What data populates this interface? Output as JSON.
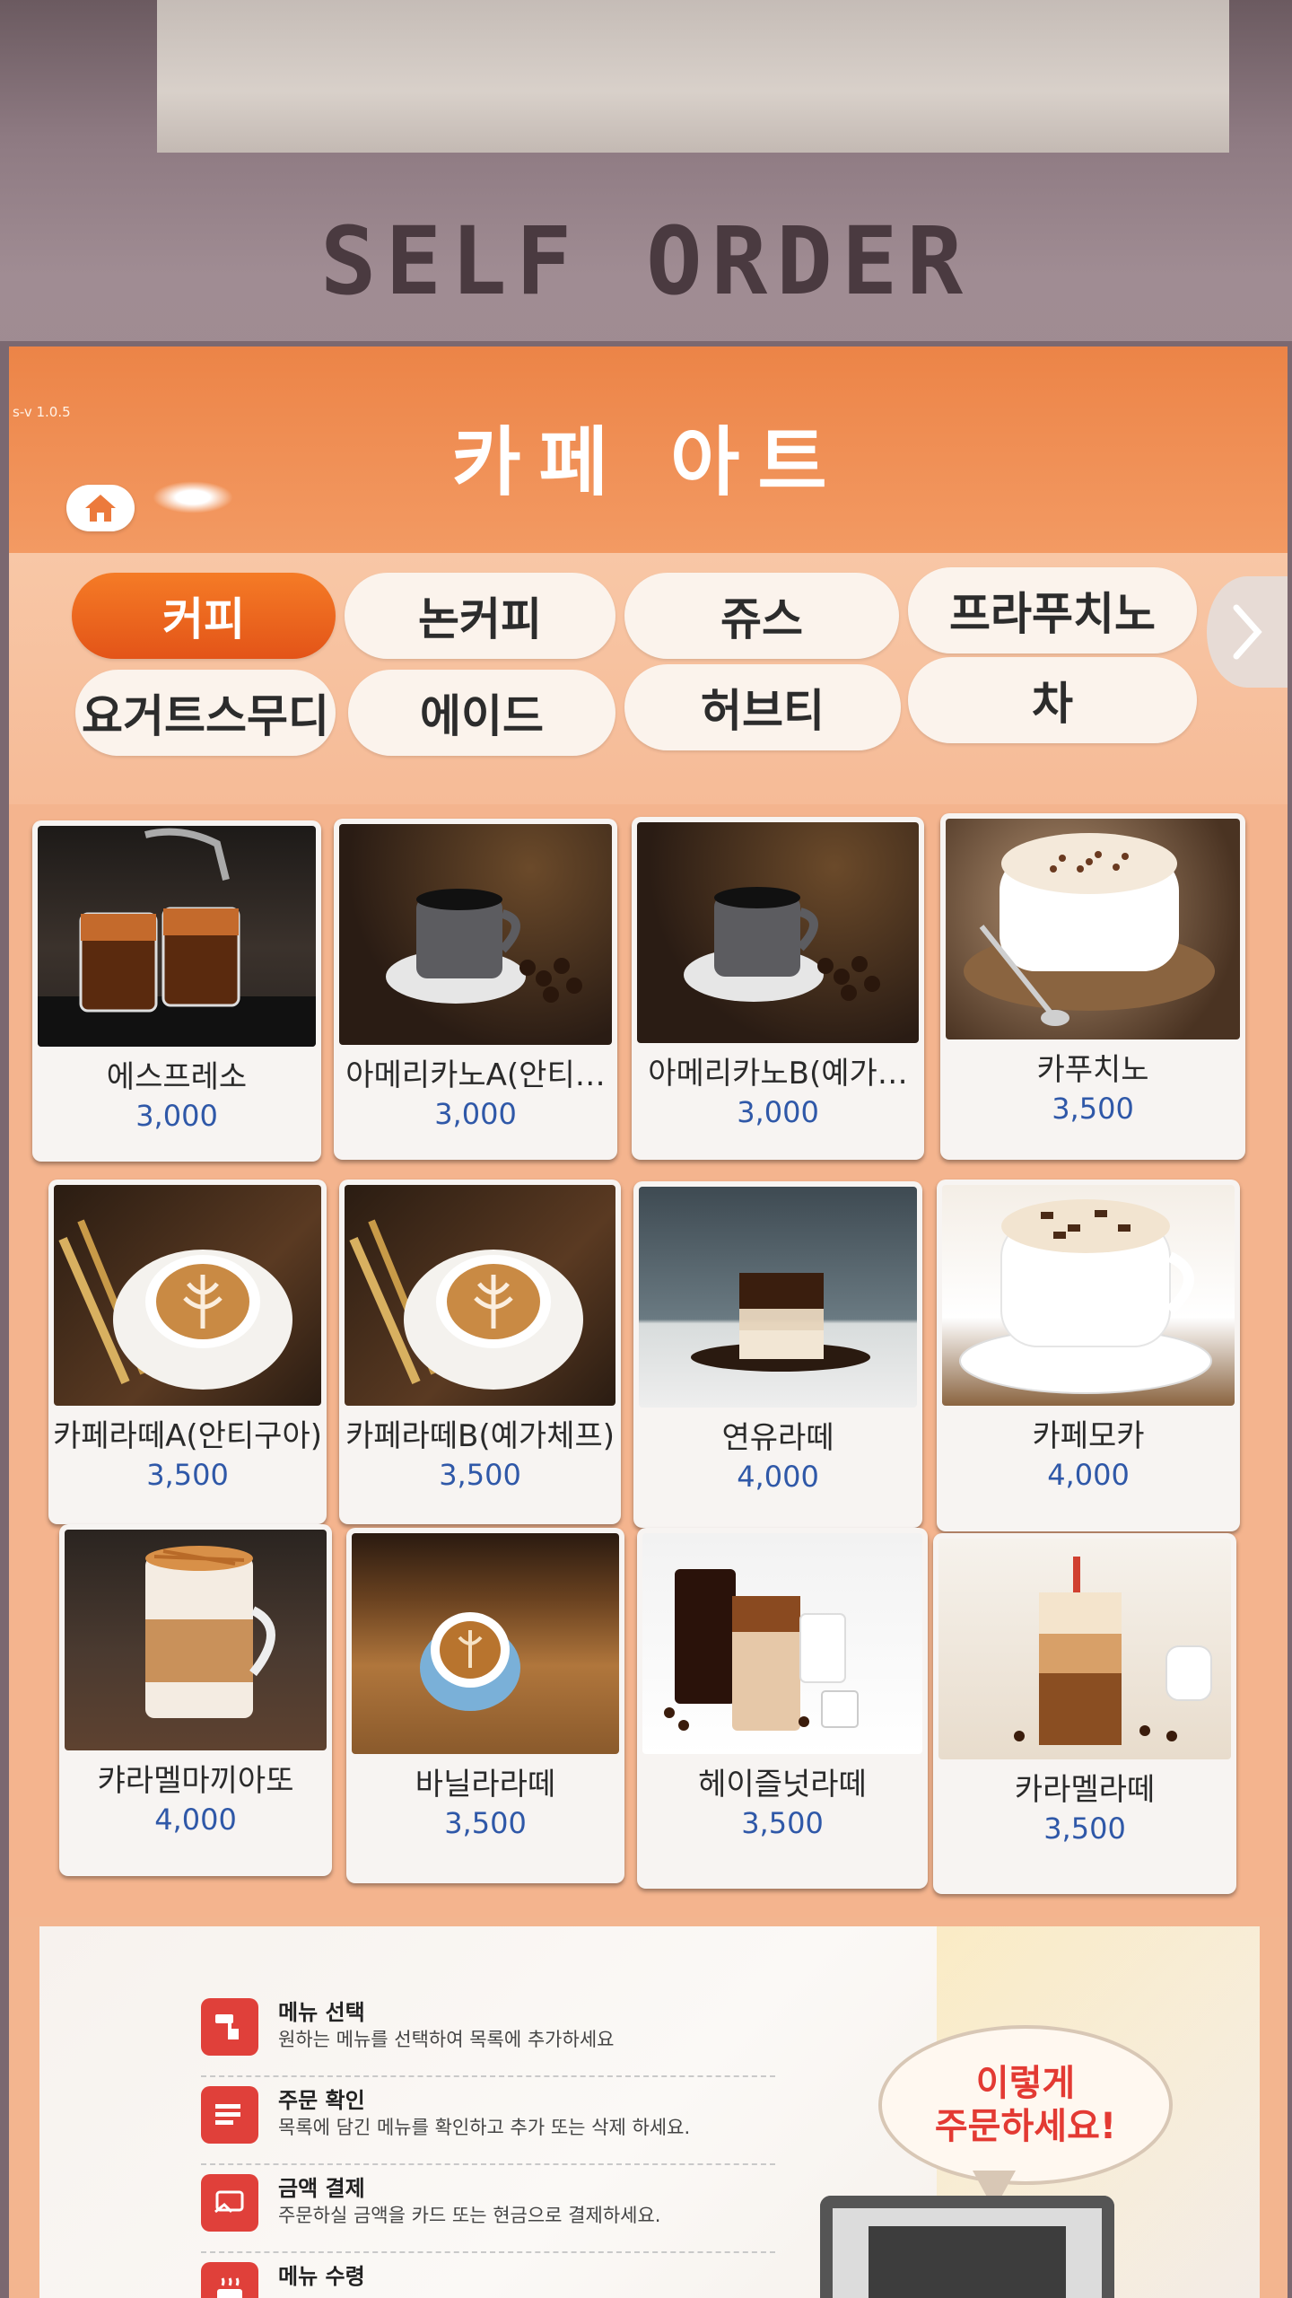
{
  "kiosk": {
    "label": "SELF ORDER"
  },
  "header": {
    "version": "s-v 1.0.5",
    "title": "카페 아트",
    "home_icon": "home-icon"
  },
  "categories": [
    {
      "label": "커피",
      "active": true
    },
    {
      "label": "논커피",
      "active": false
    },
    {
      "label": "쥬스",
      "active": false
    },
    {
      "label": "프라푸치노",
      "active": false
    },
    {
      "label": "요거트스무디",
      "active": false
    },
    {
      "label": "에이드",
      "active": false
    },
    {
      "label": "허브티",
      "active": false
    },
    {
      "label": "차",
      "active": false
    }
  ],
  "next_icon": "chevron-right-icon",
  "products": [
    {
      "name": "에스프레소",
      "price": "3,000"
    },
    {
      "name": "아메리카노A(안티…",
      "price": "3,000"
    },
    {
      "name": "아메리카노B(예가…",
      "price": "3,000"
    },
    {
      "name": "카푸치노",
      "price": "3,500"
    },
    {
      "name": "카페라떼A(안티구아)",
      "price": "3,500"
    },
    {
      "name": "카페라떼B(예가체프)",
      "price": "3,500"
    },
    {
      "name": "연유라떼",
      "price": "4,000"
    },
    {
      "name": "카페모카",
      "price": "4,000"
    },
    {
      "name": "캬라멜마끼아또",
      "price": "4,000"
    },
    {
      "name": "바닐라라떼",
      "price": "3,500"
    },
    {
      "name": "헤이즐넛라떼",
      "price": "3,500"
    },
    {
      "name": "카라멜라떼",
      "price": "3,500"
    }
  ],
  "guide": {
    "steps": [
      {
        "title": "메뉴 선택",
        "desc": "원하는 메뉴를 선택하여 목록에 추가하세요",
        "icon": "touch-icon"
      },
      {
        "title": "주문 확인",
        "desc": "목록에 담긴 메뉴를 확인하고 추가 또는 삭제 하세요.",
        "icon": "list-icon"
      },
      {
        "title": "금액 결제",
        "desc": "주문하실 금액을 카드 또는 현금으로 결제하세요.",
        "icon": "card-icon"
      },
      {
        "title": "메뉴 수령",
        "desc": "",
        "icon": "cup-icon"
      }
    ],
    "bubble_line1": "이렇게",
    "bubble_line2": "주문하세요!"
  },
  "colors": {
    "header": "#ec8447",
    "active_tab": "#e35418",
    "price": "#2f58a8",
    "accent_red": "#e33a33"
  }
}
